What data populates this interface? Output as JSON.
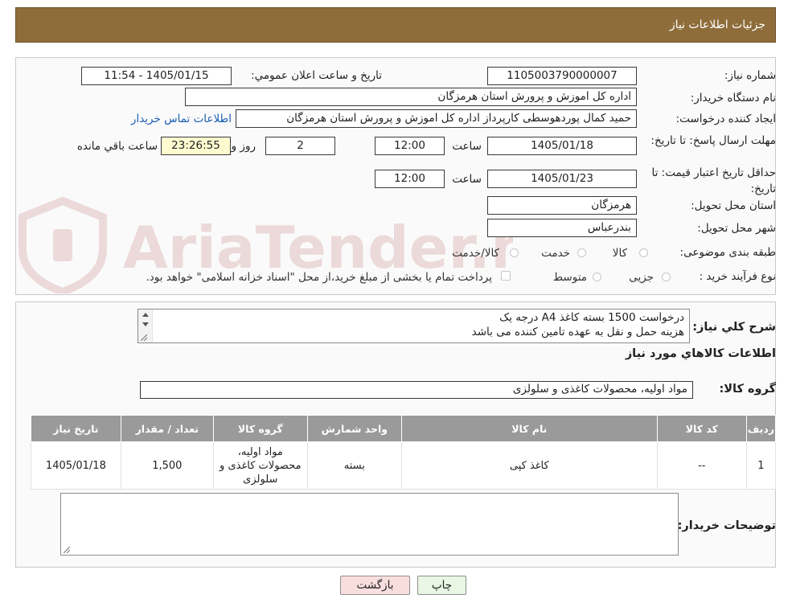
{
  "header": {
    "title": "جزئیات اطلاعات نیاز"
  },
  "form": {
    "need_number": {
      "label": "شماره نیاز:",
      "value": "1105003790000007"
    },
    "announce_datetime": {
      "label": "تاریخ و ساعت اعلان عمومي:",
      "value": "1405/01/15 - 11:54"
    },
    "buyer_org": {
      "label": "نام دستگاه خريدار:",
      "value": "اداره کل اموزش و پرورش استان هرمزگان"
    },
    "requester": {
      "label": "ايجاد کننده درخواست:",
      "value": "حمید کمال پوردهوسطی کارپرداز اداره کل اموزش و پرورش استان هرمزگان",
      "contact_link": "اطلاعات تماس خريدار"
    },
    "reply_deadline": {
      "label": "مهلت ارسال پاسخ: تا تاریخ:",
      "date": "1405/01/18",
      "time_label": "ساعت",
      "time": "12:00",
      "days": "2",
      "days_label": "روز و",
      "remaining": "23:26:55",
      "remaining_label": "ساعت باقي مانده"
    },
    "price_validity": {
      "label": "حداقل تاريخ اعتبار قيمت: تا تاريخ:",
      "date": "1405/01/23",
      "time_label": "ساعت",
      "time": "12:00"
    },
    "delivery_province": {
      "label": "استان محل تحويل:",
      "value": "هرمزگان"
    },
    "delivery_city": {
      "label": "شهر محل تحويل:",
      "value": "بندرعباس"
    },
    "category": {
      "label": "طبقه بندی موضوعی:",
      "options": [
        "کالا",
        "خدمت",
        "کالا/خدمت"
      ]
    },
    "purchase_type": {
      "label": "نوع فرآیند خرید :",
      "options": [
        "جزیی",
        "متوسط"
      ],
      "payment_note": "پرداخت تمام یا بخشی از مبلغ خرید،از محل \"اسناد خزانه اسلامی\" خواهد بود."
    }
  },
  "description": {
    "label": "شرح کلي نياز:",
    "lines": [
      "درخواست 1500 بسته کاغذ A4 درجه یک",
      "هزینه حمل و نقل به عهده تامین کننده می باشد"
    ]
  },
  "goods": {
    "section_title": "اطلاعات کالاهاي مورد نياز",
    "group_label": "گروه کالا:",
    "group_value": "مواد اولیه، محصولات کاغذی و سلولزی",
    "columns": [
      "رديف",
      "کد کالا",
      "نام کالا",
      "واحد شمارش",
      "گروه کالا",
      "تعداد / مقدار",
      "تاريخ نياز"
    ],
    "rows": [
      {
        "row": "1",
        "code": "--",
        "name": "کاغذ کپی",
        "unit": "بسته",
        "group": "مواد اولیه، محصولات کاغذی و سلولزی",
        "qty": "1,500",
        "date": "1405/01/18"
      }
    ]
  },
  "buyer_notes": {
    "label": "توضيحات خريدار:"
  },
  "buttons": {
    "print": "چاپ",
    "back": "بازگشت"
  },
  "watermark": {
    "text": "AriaTender.neT"
  },
  "colors": {
    "header": "#8e6d3b",
    "back_button": "#f9dede",
    "print_button": "#e8f6e3"
  }
}
